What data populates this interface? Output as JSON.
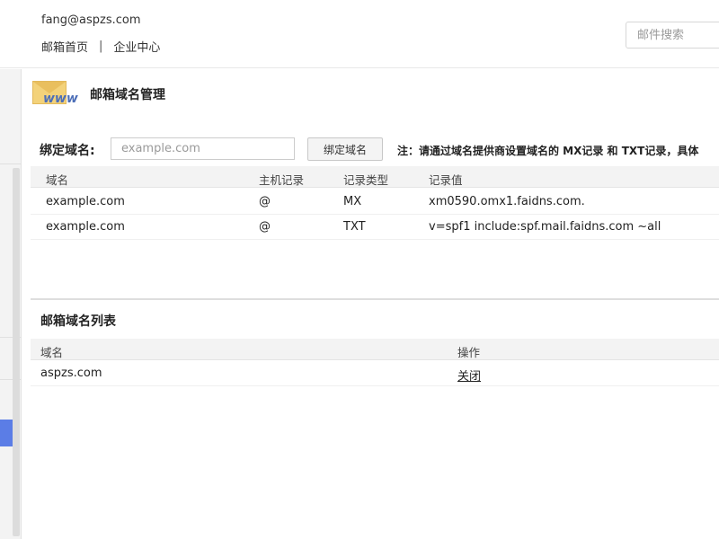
{
  "header": {
    "user_email": "fang@aspzs.com",
    "nav": [
      {
        "label": "邮箱首页"
      },
      {
        "label": "企业中心"
      }
    ],
    "nav_separator": "|",
    "search": {
      "placeholder": "邮件搜索",
      "value": ""
    }
  },
  "page": {
    "icon": "mail-www-icon",
    "icon_text": "www",
    "title": "邮箱域名管理"
  },
  "bind": {
    "label": "绑定域名:",
    "input_placeholder": "example.com",
    "input_value": "",
    "button_label": "绑定域名",
    "note": "注：请通过域名提供商设置域名的 MX记录 和 TXT记录，具体"
  },
  "dns_table": {
    "columns": [
      "域名",
      "主机记录",
      "记录类型",
      "记录值"
    ],
    "rows": [
      [
        "example.com",
        "@",
        "MX",
        "xm0590.omx1.faidns.com."
      ],
      [
        "example.com",
        "@",
        "TXT",
        "v=spf1 include:spf.mail.faidns.com ~all"
      ]
    ]
  },
  "domain_list": {
    "title": "邮箱域名列表",
    "columns": [
      "域名",
      "操作"
    ],
    "rows": [
      {
        "domain": "aspzs.com",
        "action": "关闭"
      }
    ]
  },
  "colors": {
    "accent": "#5b7de6",
    "envelope": "#f3d27a",
    "www_text": "#4d6fb8",
    "header_bg": "#f3f3f3"
  }
}
